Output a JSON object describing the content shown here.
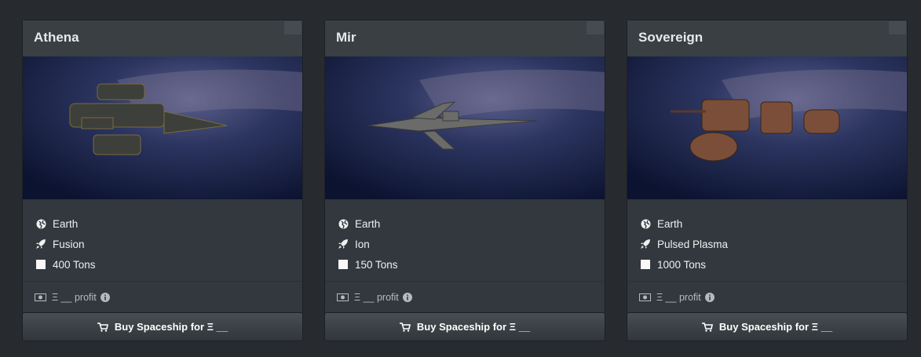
{
  "ships": [
    {
      "name": "Athena",
      "image_icon": "spaceship-image",
      "origin": "Earth",
      "propulsion": "Fusion",
      "mass": "400 Tons",
      "profit": "Ξ __ profit",
      "buy_label": "Buy Spaceship for Ξ __"
    },
    {
      "name": "Mir",
      "image_icon": "spaceship-image",
      "origin": "Earth",
      "propulsion": "Ion",
      "mass": "150 Tons",
      "profit": "Ξ __ profit",
      "buy_label": "Buy Spaceship for Ξ __"
    },
    {
      "name": "Sovereign",
      "image_icon": "spaceship-image",
      "origin": "Earth",
      "propulsion": "Pulsed Plasma",
      "mass": "1000 Tons",
      "profit": "Ξ __ profit",
      "buy_label": "Buy Spaceship for Ξ __"
    }
  ],
  "colors": {
    "background": "#272b30",
    "card": "#32383e",
    "header": "#3a3f44"
  }
}
